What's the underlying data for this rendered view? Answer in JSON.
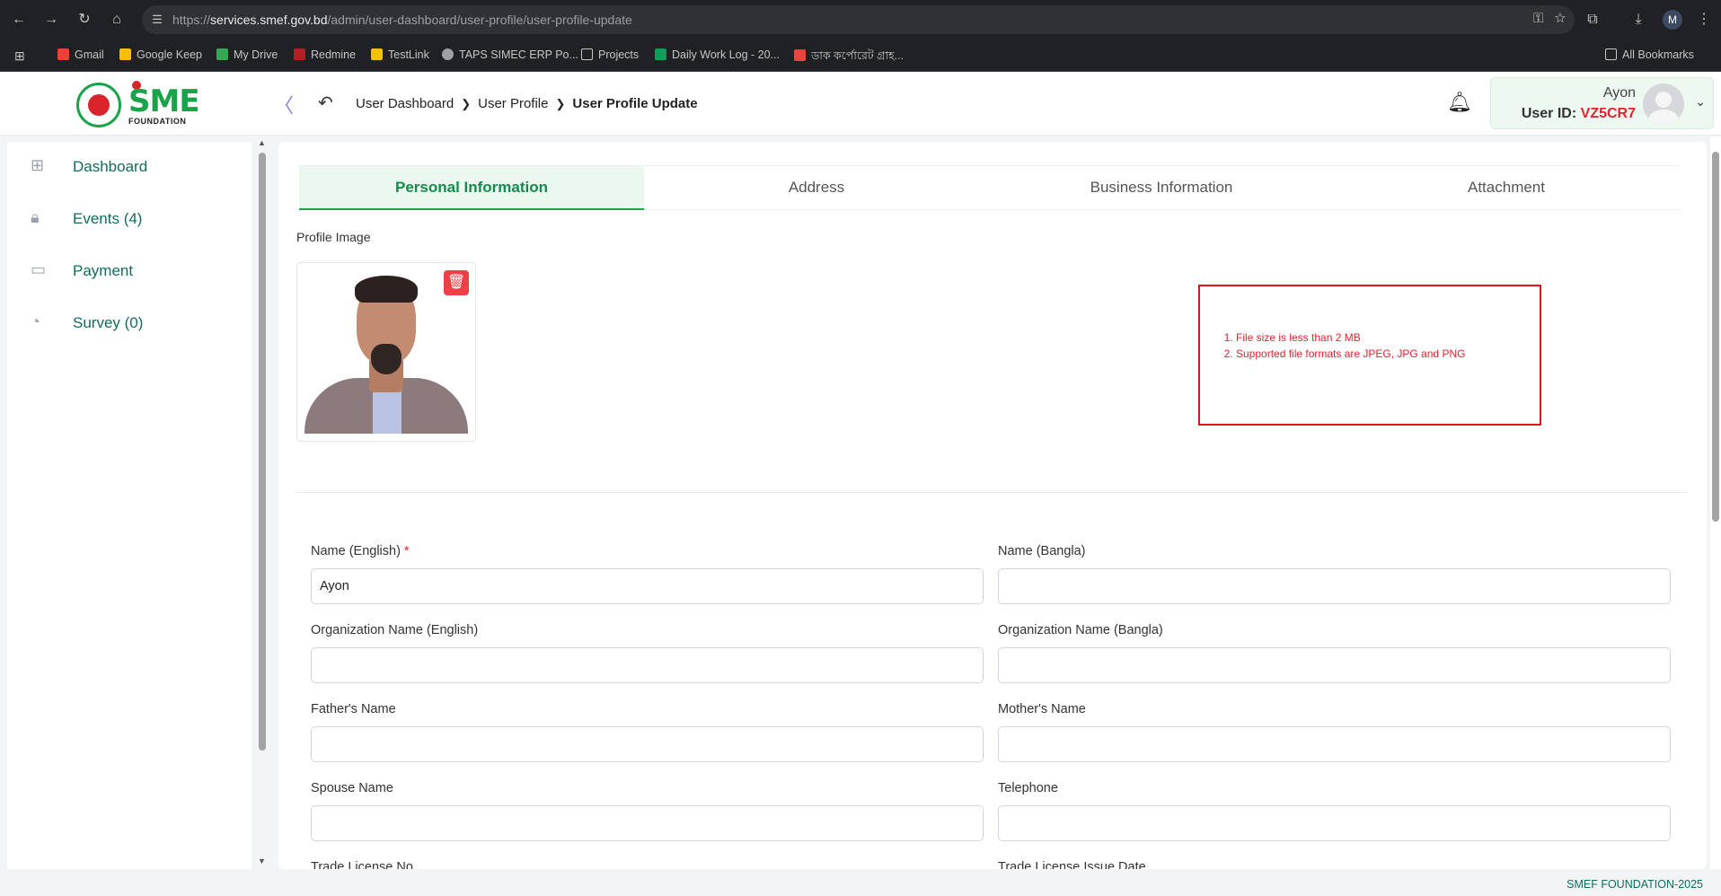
{
  "browser": {
    "url_prefix": "https://",
    "url_host": "services.smef.gov.bd",
    "url_path": "/admin/user-dashboard/user-profile/user-profile-update",
    "profile_initial": "M",
    "bookmarks": [
      {
        "label": "Gmail",
        "color": "#ea4335"
      },
      {
        "label": "Google Keep",
        "color": "#fbbc04"
      },
      {
        "label": "My Drive",
        "color": "#34a853"
      },
      {
        "label": "Redmine",
        "color": "#b32024"
      },
      {
        "label": "TestLink",
        "color": "#f2c200"
      },
      {
        "label": "TAPS SIMEC ERP Po...",
        "color": "#9aa0a6"
      },
      {
        "label": "Projects",
        "color": "#9aa0a6"
      },
      {
        "label": "Daily Work Log - 20...",
        "color": "#0f9d58"
      },
      {
        "label": "ডাক কর্পোরেট গ্রাহ...",
        "color": "#e8453c"
      }
    ],
    "all_bookmarks": "All Bookmarks"
  },
  "header": {
    "logo_text": "SME",
    "logo_sub": "FOUNDATION",
    "breadcrumb": [
      "User Dashboard",
      "User Profile",
      "User Profile Update"
    ],
    "user_name": "Ayon",
    "user_id_label": "User ID:",
    "user_id_value": "VZ5CR7"
  },
  "sidebar": {
    "items": [
      {
        "label": "Dashboard",
        "icon": "grid-icon"
      },
      {
        "label": "Events (4)",
        "icon": "lock-icon"
      },
      {
        "label": "Payment",
        "icon": "money-icon"
      },
      {
        "label": "Survey (0)",
        "icon": "pie-chart-icon"
      }
    ]
  },
  "tabs": [
    "Personal Information",
    "Address",
    "Business Information",
    "Attachment"
  ],
  "active_tab": 0,
  "profile": {
    "image_label": "Profile Image",
    "notes": [
      "File size is less than 2 MB",
      "Supported file formats are JPEG, JPG and PNG"
    ]
  },
  "form": {
    "name_en_label": "Name (English)",
    "name_en_required": "*",
    "name_en_value": "Ayon",
    "name_bn_label": "Name (Bangla)",
    "name_bn_value": "",
    "org_en_label": "Organization Name (English)",
    "org_en_value": "",
    "org_bn_label": "Organization Name (Bangla)",
    "org_bn_value": "",
    "father_label": "Father's Name",
    "father_value": "",
    "mother_label": "Mother's Name",
    "mother_value": "",
    "spouse_label": "Spouse Name",
    "spouse_value": "",
    "telephone_label": "Telephone",
    "telephone_value": "",
    "trade_no_label": "Trade License No",
    "trade_date_label": "Trade License Issue Date"
  },
  "footer": {
    "text": "SMEF FOUNDATION-2025"
  }
}
